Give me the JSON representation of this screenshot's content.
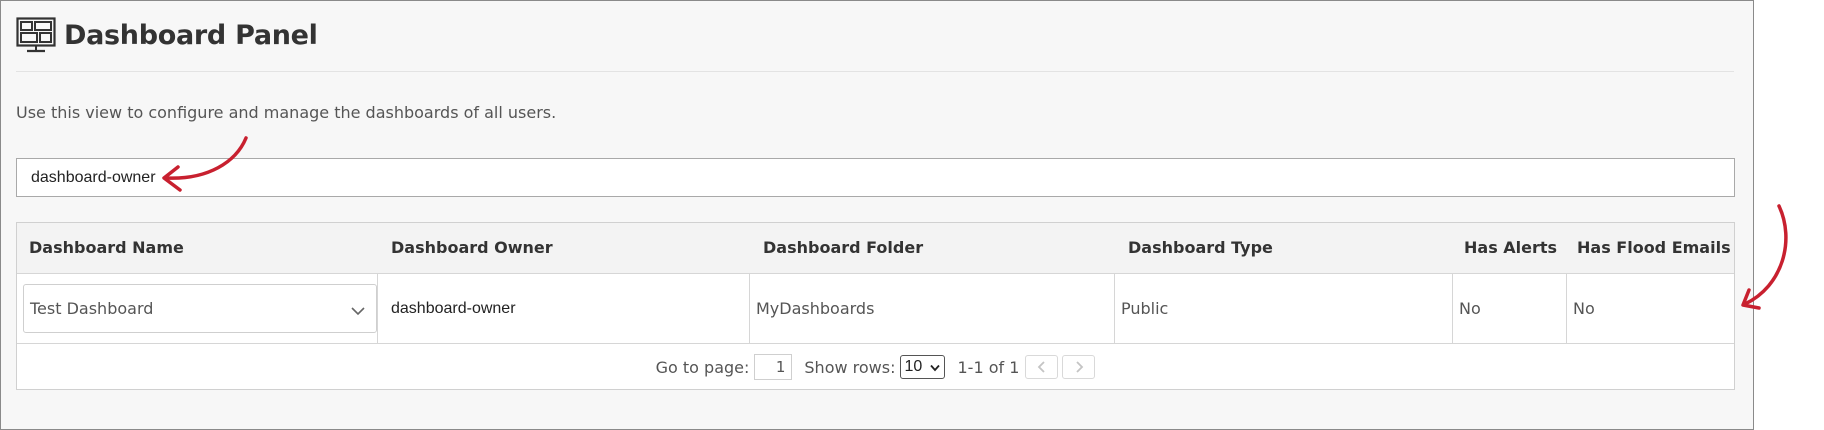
{
  "header": {
    "title": "Dashboard Panel",
    "icon": "dashboard-grid-icon"
  },
  "description": "Use this view to configure and manage the dashboards of all users.",
  "filter": {
    "value": "dashboard-owner"
  },
  "table": {
    "columns": [
      "Dashboard Name",
      "Dashboard Owner",
      "Dashboard Folder",
      "Dashboard Type",
      "Has Alerts",
      "Has Flood Emails"
    ],
    "rows": [
      {
        "name": "Test Dashboard",
        "owner": "dashboard-owner",
        "folder": "MyDashboards",
        "type": "Public",
        "has_alerts": "No",
        "has_flood_emails": "No"
      }
    ]
  },
  "pagination": {
    "go_to_label": "Go to page:",
    "page": "1",
    "show_rows_label": "Show rows:",
    "rows_per_page": "10",
    "range_text": "1-1 of 1"
  },
  "annotations": {
    "arrow_color": "#c8202f"
  }
}
